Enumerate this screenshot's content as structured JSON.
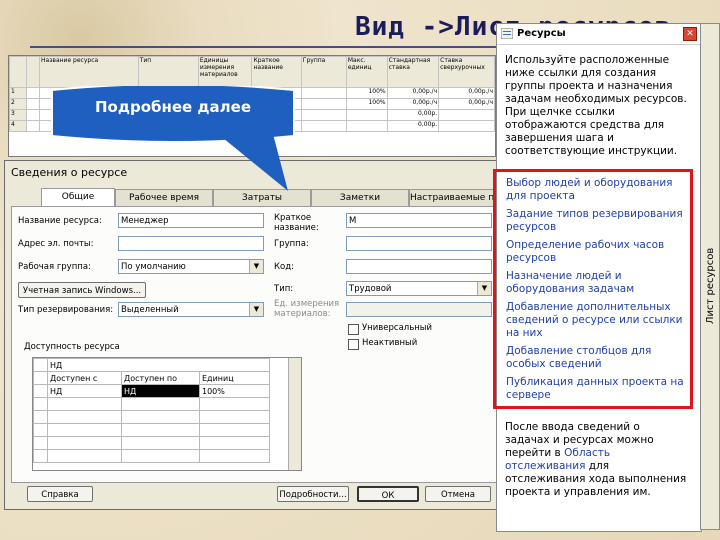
{
  "slide": {
    "title": "Вид ->Лист ресурсов"
  },
  "sheet": {
    "headers": [
      "",
      "",
      "Название ресурса",
      "Тип",
      "Единицы измерения материалов",
      "Краткое название",
      "Группа",
      "Макс. единиц",
      "Стандартная ставка",
      "Ставка сверхурочных"
    ],
    "rows": [
      {
        "n": "1",
        "max": "100%",
        "std": "0,00р./ч",
        "ovt": "0,00р./ч"
      },
      {
        "n": "2",
        "max": "100%",
        "std": "0,00р./ч",
        "ovt": "0,00р./ч"
      },
      {
        "n": "3",
        "max": "",
        "std": "0,00р.",
        "ovt": ""
      },
      {
        "n": "4",
        "max": "",
        "std": "0,00р.",
        "ovt": ""
      }
    ]
  },
  "callout": {
    "text": "Подробнее далее"
  },
  "dialog": {
    "title": "Сведения о ресурсе",
    "tabs": [
      "Общие",
      "Рабочее время",
      "Затраты",
      "Заметки",
      "Настраиваемые поля"
    ],
    "labels": {
      "name": "Название ресурса:",
      "email": "Адрес эл. почты:",
      "workgroup": "Рабочая группа:",
      "account": "Учетная запись Windows...",
      "booking": "Тип резервирования:",
      "initials": "Краткое название:",
      "group": "Группа:",
      "code": "Код:",
      "type": "Тип:",
      "material": "Ед. измерения материалов:",
      "generic": "Универсальный",
      "inactive": "Неактивный",
      "availability": "Доступность ресурса"
    },
    "values": {
      "name": "Менеджер",
      "email": "",
      "workgroup": "По умолчанию",
      "booking": "Выделенный",
      "initials": "М",
      "group": "",
      "code": "",
      "type": "Трудовой",
      "material": ""
    },
    "availability": {
      "top": "НД",
      "headers": [
        "Доступен с",
        "Доступен по",
        "Единиц"
      ],
      "row": [
        "НД",
        "НД",
        "100%"
      ]
    },
    "buttons": {
      "help": "Справка",
      "details": "Подробности...",
      "ok": "ОК",
      "cancel": "Отмена"
    }
  },
  "pane": {
    "title": "Ресурсы",
    "intro": "Используйте расположенные ниже ссылки для создания группы проекта и назначения задачам необходимых ресурсов. При щелчке ссылки отображаются средства для завершения шага и соответствующие инструкции.",
    "links": [
      "Выбор людей и оборудования для проекта",
      "Задание типов резервирования ресурсов",
      "Определение рабочих часов ресурсов",
      "Назначение людей и оборудования задачам",
      "Добавление дополнительных сведений о ресурсе или ссылки на них",
      "Добавление столбцов для особых сведений",
      "Публикация данных проекта на сервере"
    ],
    "footer_a": "После ввода сведений о задачах и ресурсах можно перейти в",
    "footer_link": "Область отслеживания",
    "footer_b": "для отслеживания хода выполнения проекта и управления им.",
    "side_label": "Лист ресурсов"
  },
  "colors": {
    "title": "#1c1c5a",
    "link": "#1f3fa8",
    "highlight": "#e0151b",
    "callout": "#1f5fbf"
  }
}
